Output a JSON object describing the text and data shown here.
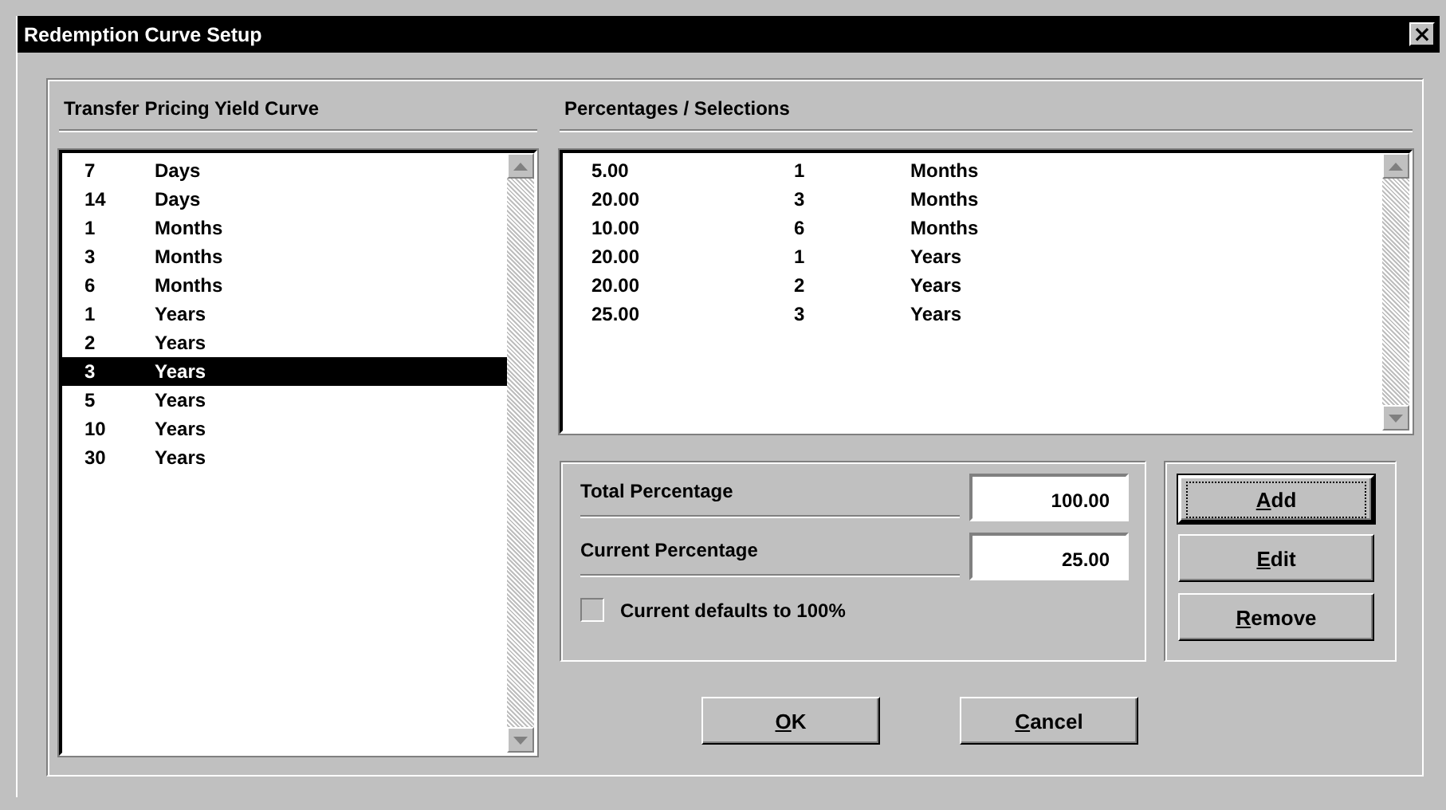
{
  "window": {
    "title": "Redemption Curve Setup",
    "close": "×"
  },
  "yield_curve": {
    "heading": "Transfer Pricing Yield Curve",
    "items": [
      {
        "term": "7",
        "unit": "Days",
        "selected": false
      },
      {
        "term": "14",
        "unit": "Days",
        "selected": false
      },
      {
        "term": "1",
        "unit": "Months",
        "selected": false
      },
      {
        "term": "3",
        "unit": "Months",
        "selected": false
      },
      {
        "term": "6",
        "unit": "Months",
        "selected": false
      },
      {
        "term": "1",
        "unit": "Years",
        "selected": false
      },
      {
        "term": "2",
        "unit": "Years",
        "selected": false
      },
      {
        "term": "3",
        "unit": "Years",
        "selected": true
      },
      {
        "term": "5",
        "unit": "Years",
        "selected": false
      },
      {
        "term": "10",
        "unit": "Years",
        "selected": false
      },
      {
        "term": "30",
        "unit": "Years",
        "selected": false
      }
    ]
  },
  "selections": {
    "heading": "Percentages / Selections",
    "rows": [
      {
        "percent": "5.00",
        "term": "1",
        "unit": "Months"
      },
      {
        "percent": "20.00",
        "term": "3",
        "unit": "Months"
      },
      {
        "percent": "10.00",
        "term": "6",
        "unit": "Months"
      },
      {
        "percent": "20.00",
        "term": "1",
        "unit": "Years"
      },
      {
        "percent": "20.00",
        "term": "2",
        "unit": "Years"
      },
      {
        "percent": "25.00",
        "term": "3",
        "unit": "Years"
      }
    ]
  },
  "fields": [
    {
      "label": "Total Percentage",
      "value": "100.00"
    },
    {
      "label": "Current Percentage",
      "value": "25.00"
    }
  ],
  "checkbox": {
    "label": "Current defaults to 100%",
    "checked": false
  },
  "side_buttons": [
    {
      "label": "Add",
      "default": true
    },
    {
      "label": "Edit",
      "default": false
    },
    {
      "label": "Remove",
      "default": false
    }
  ],
  "buttons": [
    {
      "label": "OK",
      "default": false
    },
    {
      "label": "Cancel",
      "default": false
    }
  ]
}
